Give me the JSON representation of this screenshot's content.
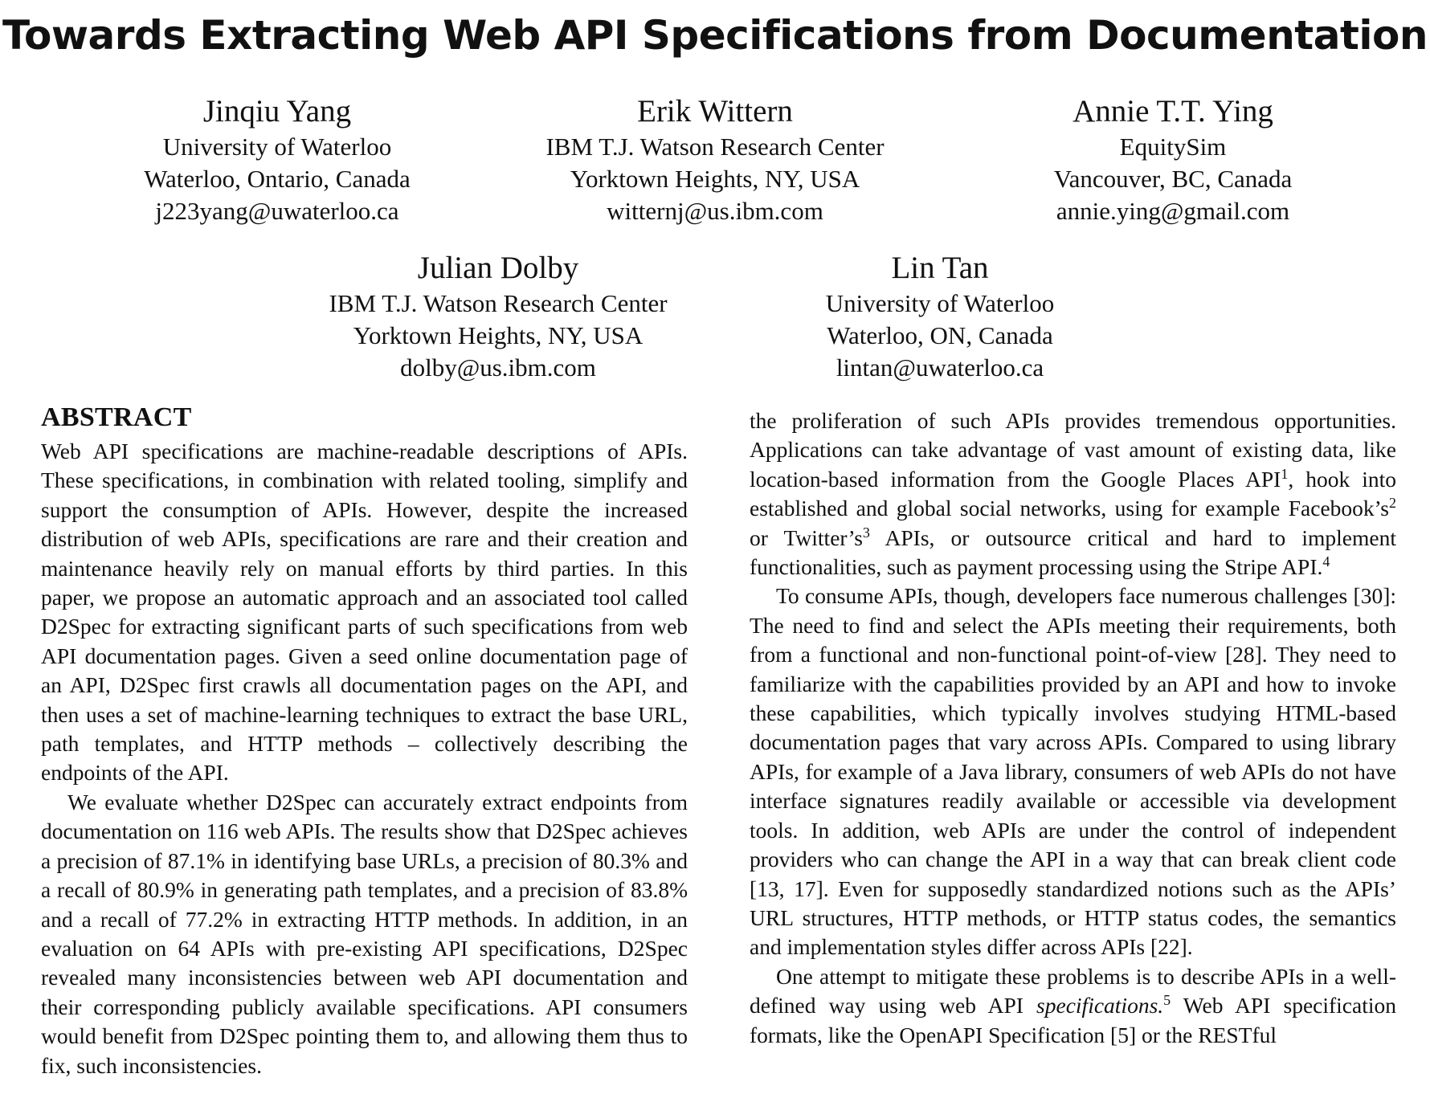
{
  "paper": {
    "title": "Towards Extracting Web API Specifications from Documentation",
    "authors": [
      {
        "name": "Jinqiu Yang",
        "affiliation": "University of Waterloo",
        "location": "Waterloo, Ontario, Canada",
        "email": "j223yang@uwaterloo.ca"
      },
      {
        "name": "Erik Wittern",
        "affiliation": "IBM T.J. Watson Research Center",
        "location": "Yorktown Heights, NY, USA",
        "email": "witternj@us.ibm.com"
      },
      {
        "name": "Annie T.T. Ying",
        "affiliation": "EquitySim",
        "location": "Vancouver, BC, Canada",
        "email": "annie.ying@gmail.com"
      },
      {
        "name": "Julian Dolby",
        "affiliation": "IBM T.J. Watson Research Center",
        "location": "Yorktown Heights, NY, USA",
        "email": "dolby@us.ibm.com"
      },
      {
        "name": "Lin Tan",
        "affiliation": "University of Waterloo",
        "location": "Waterloo, ON, Canada",
        "email": "lintan@uwaterloo.ca"
      }
    ],
    "abstract_heading": "ABSTRACT",
    "abstract_p1": "Web API specifications are machine-readable descriptions of APIs. These specifications, in combination with related tooling, simplify and support the consumption of APIs. However, despite the increased distribution of web APIs, specifications are rare and their creation and maintenance heavily rely on manual efforts by third parties. In this paper, we propose an automatic approach and an associated tool called D2Spec for extracting significant parts of such specifications from web API documentation pages. Given a seed online documentation page of an API, D2Spec first crawls all documentation pages on the API, and then uses a set of machine-learning techniques to extract the base URL, path templates, and HTTP methods – collectively describing the endpoints of the API.",
    "abstract_p2": "We evaluate whether D2Spec can accurately extract endpoints from documentation on 116 web APIs. The results show that D2Spec achieves a precision of 87.1% in identifying base URLs, a precision of 80.3% and a recall of 80.9% in generating path templates, and a precision of 83.8% and a recall of 77.2% in extracting HTTP methods. In addition, in an evaluation on 64 APIs with pre-existing API specifications, D2Spec revealed many inconsistencies between web API documentation and their corresponding publicly available specifications. API consumers would benefit from D2Spec pointing them to, and allowing them thus to fix, such inconsistencies.",
    "right_p1": {
      "s1": "the proliferation of such APIs provides tremendous opportunities. Applications can take advantage of vast amount of existing data, like location-based information from the Google Places API",
      "fn1": "1",
      "s2": ", hook into established and global social networks, using for example Facebook’s",
      "fn2": "2",
      "s3": " or Twitter’s",
      "fn3": "3",
      "s4": " APIs, or outsource critical and hard to implement functionalities, such as payment processing using the Stripe API.",
      "fn4": "4"
    },
    "right_p2": "To consume APIs, though, developers face numerous challenges [30]: The need to find and select the APIs meeting their requirements, both from a functional and non-functional point-of-view [28]. They need to familiarize with the capabilities provided by an API and how to invoke these capabilities, which typically involves studying HTML-based documentation pages that vary across APIs. Compared to using library APIs, for example of a Java library, consumers of web APIs do not have interface signatures readily available or accessible via development tools. In addition, web APIs are under the control of independent providers who can change the API in a way that can break client code [13, 17]. Even for supposedly standardized notions such as the APIs’ URL structures, HTTP methods, or HTTP status codes, the semantics and implementation styles differ across APIs [22].",
    "right_p3": {
      "s1": "One attempt to mitigate these problems is to describe APIs in a well-defined way using web API ",
      "em": "specifications.",
      "fn": "5",
      "s2": " Web API specification formats, like the OpenAPI Specification [5] or the RESTful"
    }
  }
}
